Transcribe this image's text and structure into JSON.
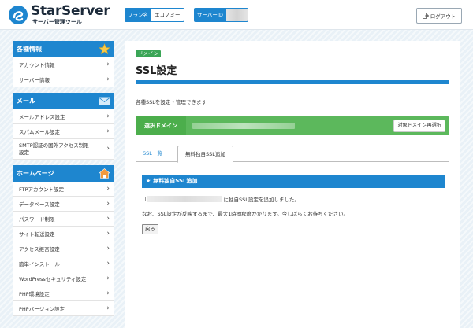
{
  "header": {
    "logo_title": "StarServer",
    "logo_subtitle": "サーバー管理ツール",
    "plan_label": "プラン名",
    "plan_value": "エコノミー",
    "server_id_label": "サーバーID",
    "logout_label": "ログアウト"
  },
  "sidebar": {
    "groups": [
      {
        "title": "各種情報",
        "icon": "star-icon",
        "items": [
          {
            "label": "アカウント情報"
          },
          {
            "label": "サーバー情報"
          }
        ]
      },
      {
        "title": "メール",
        "icon": "envelope-icon",
        "items": [
          {
            "label": "メールアドレス設定"
          },
          {
            "label": "スパムメール設定"
          },
          {
            "label": "SMTP認証の国外アクセス制限\n設定"
          }
        ]
      },
      {
        "title": "ホームページ",
        "icon": "house-icon",
        "items": [
          {
            "label": "FTPアカウント設定"
          },
          {
            "label": "データベース設定"
          },
          {
            "label": "パスワード制限"
          },
          {
            "label": "サイト転送設定"
          },
          {
            "label": "アクセス拒否設定"
          },
          {
            "label": "簡単インストール"
          },
          {
            "label": "WordPressセキュリティ設定"
          },
          {
            "label": "PHP環境設定"
          },
          {
            "label": "PHPバージョン設定"
          }
        ]
      }
    ]
  },
  "main": {
    "breadcrumb": "ドメイン",
    "title": "SSL設定",
    "description": "各種SSLを設定・管理できます",
    "domain_bar": {
      "label": "選択ドメイン",
      "switch_button": "対象ドメイン再選択"
    },
    "tabs": [
      {
        "label": "SSL一覧"
      },
      {
        "label": "無料独自SSL追加"
      }
    ],
    "panel": {
      "title": "無料独自SSL追加",
      "result_message": "に独自SSL設定を追加しました。",
      "note": "なお、SSL設定が反映するまで、最大1時間程度かかります。今しばらくお待ちください。",
      "back_button": "戻る"
    }
  },
  "colors": {
    "primary_blue": "#1e86cf",
    "domain_green": "#5cb85c",
    "breadcrumb_green": "#3aa556"
  }
}
